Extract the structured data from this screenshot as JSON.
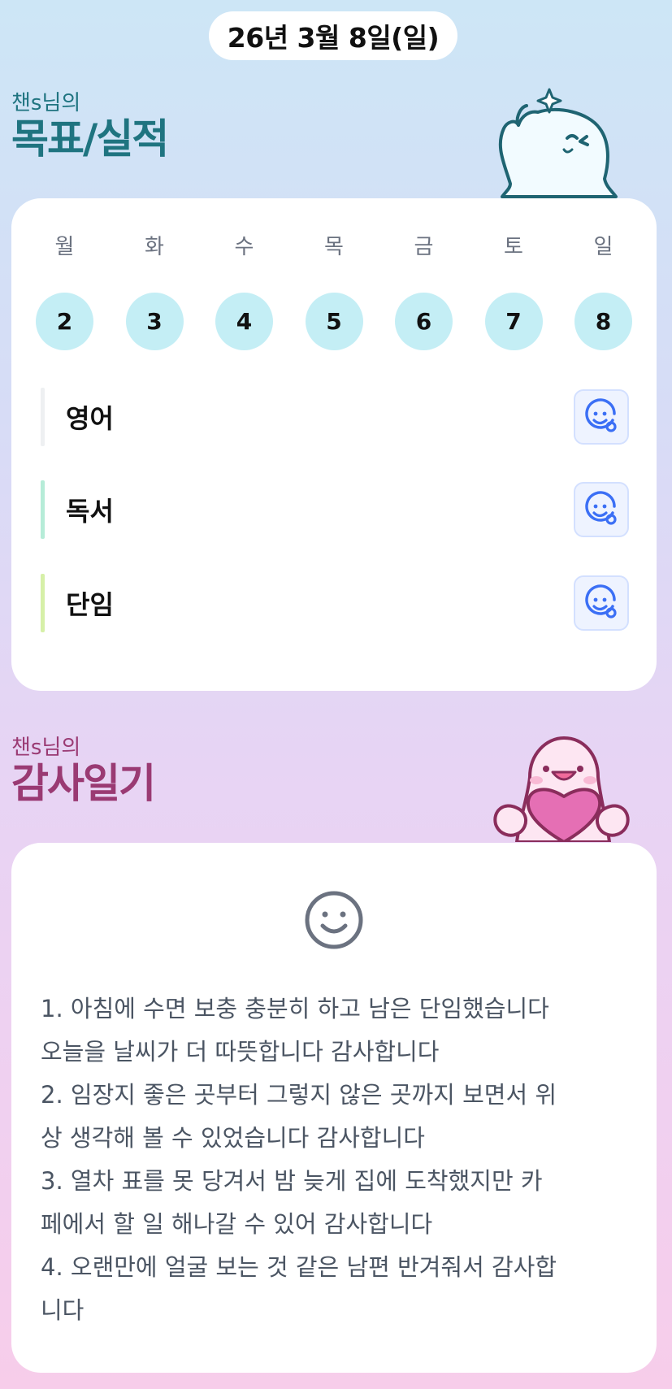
{
  "header": {
    "date": "26년 3월 8일(일)"
  },
  "goals_section": {
    "owner": "챈s님의",
    "title": "목표/실적"
  },
  "week": {
    "days": [
      {
        "label": "월",
        "num": "2"
      },
      {
        "label": "화",
        "num": "3"
      },
      {
        "label": "수",
        "num": "4"
      },
      {
        "label": "목",
        "num": "5"
      },
      {
        "label": "금",
        "num": "6"
      },
      {
        "label": "토",
        "num": "7"
      },
      {
        "label": "일",
        "num": "8"
      }
    ]
  },
  "goals": [
    {
      "name": "영어",
      "bar_color": "#eef0f2",
      "icon": "smile-add-icon"
    },
    {
      "name": "독서",
      "bar_color": "#b6ecd8",
      "icon": "smile-add-icon"
    },
    {
      "name": "단임",
      "bar_color": "#d6f0a8",
      "icon": "smile-add-icon"
    }
  ],
  "gratitude_section": {
    "owner": "챈s님의",
    "title": "감사일기"
  },
  "diary": {
    "icon": "smile-icon",
    "lines": [
      "1. 아침에 수면 보충 충분히 하고 남은 단임했습니다",
      "오늘을 날씨가 더 따뜻합니다 감사합니다",
      "2. 임장지 좋은 곳부터 그렇지 않은 곳까지 보면서 위",
      "상 생각해 볼 수 있었습니다 감사합니다",
      "3. 열차 표를 못 당겨서 밤 늦게 집에 도착했지만 카",
      "페에서 할 일 해나갈 수 있어 감사합니다",
      "4. 오랜만에 얼굴 보는 것 같은 남편 반겨줘서 감사합",
      "니다"
    ]
  },
  "colors": {
    "goal_title": "#1f7480",
    "gratitude_title": "#9a3a73",
    "day_circle": "#c4eef5",
    "emoji_icon": "#3b6ff5"
  }
}
